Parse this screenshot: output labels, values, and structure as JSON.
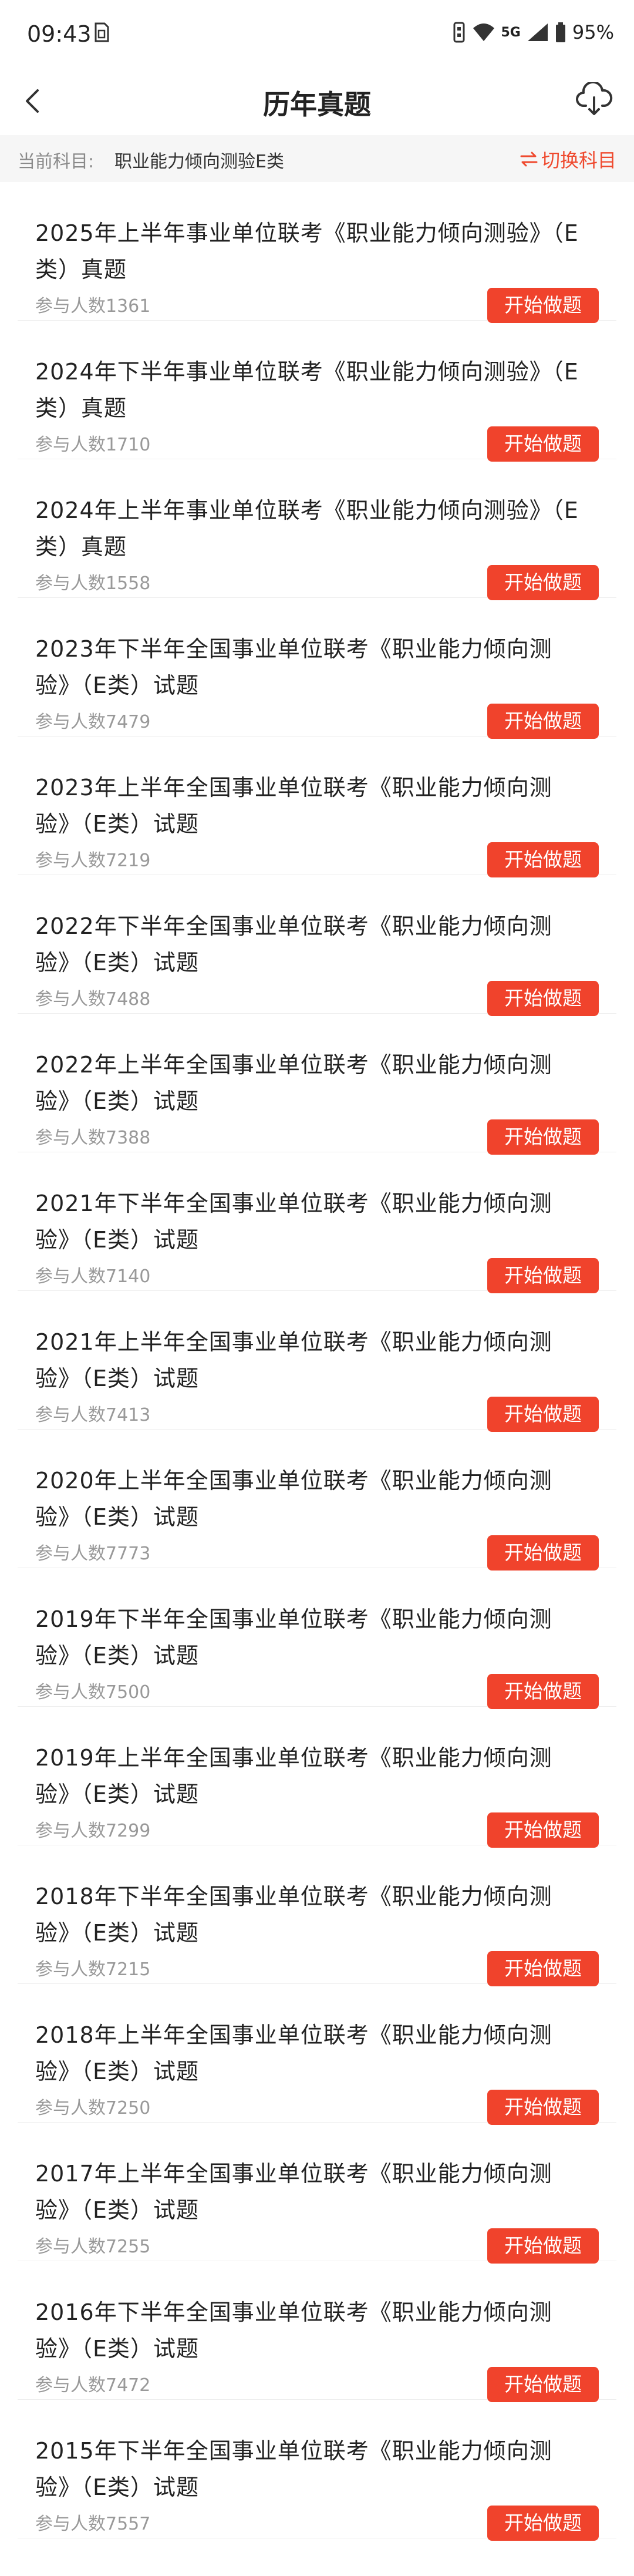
{
  "status_bar": {
    "time": "09:43",
    "network": "5G",
    "battery": "95%"
  },
  "nav": {
    "title": "历年真题",
    "back_icon": "chevron-left-icon",
    "download_icon": "cloud-download-icon"
  },
  "subject": {
    "label": "当前科目:",
    "value": "职业能力倾向测验E类",
    "switch_label": "切换科目",
    "switch_icon": "swap-arrows-icon",
    "accent_color": "#ef4a2f"
  },
  "exams": [
    {
      "title": "2025年上半年事业单位联考《职业能力倾向测验》（E类）真题",
      "count": "参与人数1361",
      "button": "开始做题"
    },
    {
      "title": "2024年下半年事业单位联考《职业能力倾向测验》（E类）真题",
      "count": "参与人数1710",
      "button": "开始做题"
    },
    {
      "title": "2024年上半年事业单位联考《职业能力倾向测验》（E类）真题",
      "count": "参与人数1558",
      "button": "开始做题"
    },
    {
      "title": "2023年下半年全国事业单位联考《职业能力倾向测验》（E类）试题",
      "count": "参与人数7479",
      "button": "开始做题"
    },
    {
      "title": "2023年上半年全国事业单位联考《职业能力倾向测验》（E类）试题",
      "count": "参与人数7219",
      "button": "开始做题"
    },
    {
      "title": "2022年下半年全国事业单位联考《职业能力倾向测验》（E类）试题",
      "count": "参与人数7488",
      "button": "开始做题"
    },
    {
      "title": "2022年上半年全国事业单位联考《职业能力倾向测验》（E类）试题",
      "count": "参与人数7388",
      "button": "开始做题"
    },
    {
      "title": "2021年下半年全国事业单位联考《职业能力倾向测验》（E类）试题",
      "count": "参与人数7140",
      "button": "开始做题"
    },
    {
      "title": "2021年上半年全国事业单位联考《职业能力倾向测验》（E类）试题",
      "count": "参与人数7413",
      "button": "开始做题"
    },
    {
      "title": "2020年上半年全国事业单位联考《职业能力倾向测验》（E类）试题",
      "count": "参与人数7773",
      "button": "开始做题"
    },
    {
      "title": "2019年下半年全国事业单位联考《职业能力倾向测验》（E类）试题",
      "count": "参与人数7500",
      "button": "开始做题"
    },
    {
      "title": "2019年上半年全国事业单位联考《职业能力倾向测验》（E类）试题",
      "count": "参与人数7299",
      "button": "开始做题"
    },
    {
      "title": "2018年下半年全国事业单位联考《职业能力倾向测验》（E类）试题",
      "count": "参与人数7215",
      "button": "开始做题"
    },
    {
      "title": "2018年上半年全国事业单位联考《职业能力倾向测验》（E类）试题",
      "count": "参与人数7250",
      "button": "开始做题"
    },
    {
      "title": "2017年上半年全国事业单位联考《职业能力倾向测验》（E类）试题",
      "count": "参与人数7255",
      "button": "开始做题"
    },
    {
      "title": "2016年下半年全国事业单位联考《职业能力倾向测验》（E类）试题",
      "count": "参与人数7472",
      "button": "开始做题"
    },
    {
      "title": "2015年下半年全国事业单位联考《职业能力倾向测验》（E类）试题",
      "count": "参与人数7557",
      "button": "开始做题"
    }
  ]
}
